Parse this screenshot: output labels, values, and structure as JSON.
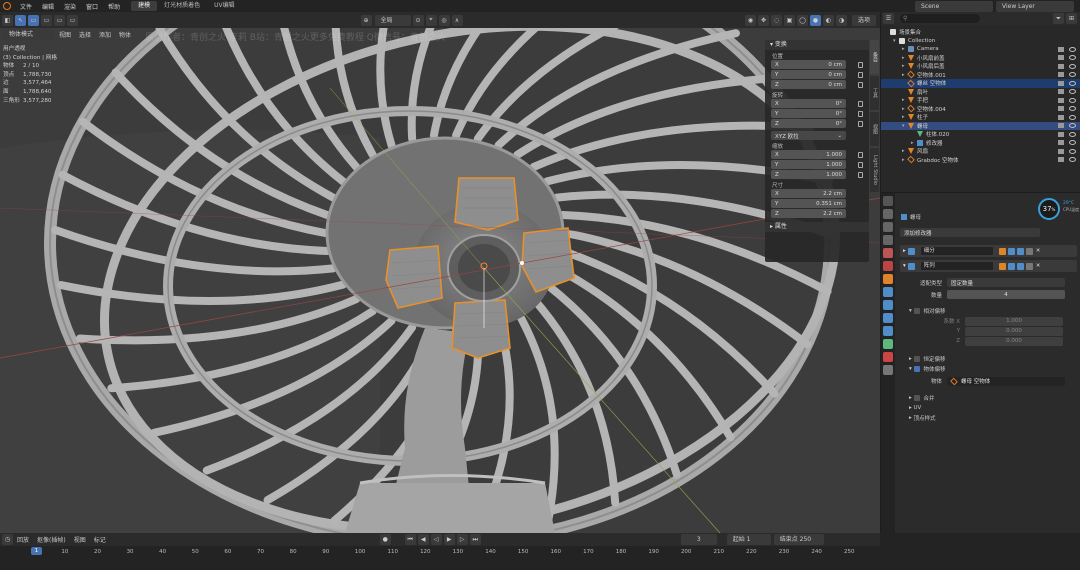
{
  "topbar": {
    "menus": [
      "文件",
      "编辑",
      "渲染",
      "窗口",
      "帮助"
    ],
    "workspace_tabs": [
      "建模",
      "灯光材质着色",
      "UV编辑"
    ],
    "active_tab": 0,
    "scene": "Scene",
    "view_layer": "View Layer"
  },
  "viewport_header": {
    "mode": "物体模式",
    "menus": [
      "视图",
      "选择",
      "添加",
      "物体"
    ],
    "orientation": "全局",
    "options": "选项"
  },
  "stats": {
    "view_name": "用户透视",
    "collection": "(3) Collection | 网格",
    "rows": [
      {
        "k": "物体",
        "v": "2 / 10"
      },
      {
        "k": "顶点",
        "v": "1,788,730"
      },
      {
        "k": "边",
        "v": "3,577,464"
      },
      {
        "k": "面",
        "v": "1,788,640"
      },
      {
        "k": "三角形",
        "v": "3,577,280"
      }
    ]
  },
  "watermark": "原创作者：青创之火·李莉   B站：青创之火更多免费教程   Q微信号：青创之火",
  "npanel": {
    "transform_title": "变换",
    "location_label": "位置",
    "location": [
      {
        "a": "X",
        "v": "0 cm"
      },
      {
        "a": "Y",
        "v": "0 cm"
      },
      {
        "a": "Z",
        "v": "0 cm"
      }
    ],
    "rotation_label": "旋转",
    "rotation": [
      {
        "a": "X",
        "v": "0°"
      },
      {
        "a": "Y",
        "v": "0°"
      },
      {
        "a": "Z",
        "v": "0°"
      }
    ],
    "rotation_mode": "XYZ 欧拉",
    "scale_label": "缩放",
    "scale": [
      {
        "a": "X",
        "v": "1.000"
      },
      {
        "a": "Y",
        "v": "1.000"
      },
      {
        "a": "Z",
        "v": "1.000"
      }
    ],
    "dimensions_label": "尺寸",
    "dimensions": [
      {
        "a": "X",
        "v": "2.2 cm"
      },
      {
        "a": "Y",
        "v": "0.351 cm"
      },
      {
        "a": "Z",
        "v": "2.2 cm"
      }
    ],
    "properties_title": "属性",
    "side_tabs": [
      "条目",
      "工具",
      "视图",
      "Light Studio"
    ]
  },
  "outliner": {
    "title": "场景集合",
    "items": [
      {
        "indent": 0,
        "label": "场景集合",
        "icon": "col",
        "tri": ""
      },
      {
        "indent": 1,
        "label": "Collection",
        "icon": "col",
        "tri": "▾"
      },
      {
        "indent": 2,
        "label": "Camera",
        "icon": "cam",
        "tri": "▸"
      },
      {
        "indent": 2,
        "label": "小风扇前盖",
        "icon": "orange",
        "tri": "▸"
      },
      {
        "indent": 2,
        "label": "小风扇后盖",
        "icon": "orange",
        "tri": "▸"
      },
      {
        "indent": 2,
        "label": "空物体.001",
        "icon": "empty",
        "tri": "▸"
      },
      {
        "indent": 2,
        "label": "螺丝 空物体",
        "icon": "empty",
        "tri": "",
        "sel": "sel2"
      },
      {
        "indent": 2,
        "label": "扇叶",
        "icon": "orange",
        "tri": ""
      },
      {
        "indent": 2,
        "label": "手把",
        "icon": "orange",
        "tri": "▸"
      },
      {
        "indent": 2,
        "label": "空物体.004",
        "icon": "empty",
        "tri": "▸"
      },
      {
        "indent": 2,
        "label": "柱子",
        "icon": "orange",
        "tri": "▸"
      },
      {
        "indent": 2,
        "label": "螺母",
        "icon": "orange",
        "tri": "▾",
        "sel": "sel"
      },
      {
        "indent": 3,
        "label": "柱体.020",
        "icon": "green",
        "tri": ""
      },
      {
        "indent": 3,
        "label": "修改器",
        "icon": "wrench",
        "tri": "▸"
      },
      {
        "indent": 2,
        "label": "风扇",
        "icon": "orange",
        "tri": "▸"
      },
      {
        "indent": 2,
        "label": "Grabdoc 空物体",
        "icon": "empty",
        "tri": "▸"
      }
    ]
  },
  "badge": {
    "value": "37",
    "unit": "%",
    "temp": "29°C",
    "cpu": "CPU温度"
  },
  "properties": {
    "object_name": "螺母",
    "add_modifier": "添加修改器",
    "modifiers": [
      {
        "name": "细分"
      },
      {
        "name": "阵列"
      }
    ],
    "fit_type_label": "适配类型",
    "fit_type_value": "固定数量",
    "count_label": "数量",
    "count_value": "4",
    "relative_offset_label": "相对偏移",
    "factor_x_label": "系数 X",
    "factor_x": "1.000",
    "factor_y_label": "Y",
    "factor_y": "0.000",
    "factor_z_label": "Z",
    "factor_z": "0.000",
    "constant_offset_label": "恒定偏移",
    "object_offset_label": "物体偏移",
    "object_label": "物体",
    "object_value": "螺母 空物体",
    "merge_label": "合并",
    "uv_label": "UV",
    "caps_label": "顶点样式"
  },
  "timeline": {
    "menus": [
      "回放",
      "抠像(插帧)",
      "视图",
      "标记"
    ],
    "current_frame": "1",
    "frame_display": "3",
    "start_label": "起始",
    "start": "1",
    "end_label": "结束点",
    "end": "250",
    "ticks": [
      "1",
      "10",
      "20",
      "30",
      "40",
      "50",
      "60",
      "70",
      "80",
      "90",
      "100",
      "110",
      "120",
      "130",
      "140",
      "150",
      "160",
      "170",
      "180",
      "190",
      "200",
      "210",
      "220",
      "230",
      "240",
      "250"
    ]
  },
  "colors": {
    "accent": "#4772b3",
    "selection_outline": "#e8902a",
    "viewport_bg": "#3f3f3f",
    "mesh": "#b8b8b8"
  }
}
